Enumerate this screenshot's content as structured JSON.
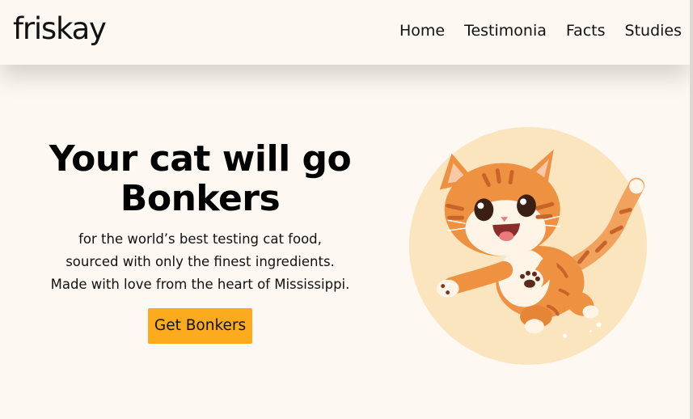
{
  "brand": {
    "logo_text": "friskay"
  },
  "nav": {
    "items": [
      {
        "label": "Home"
      },
      {
        "label": "Testimonia"
      },
      {
        "label": "Facts"
      },
      {
        "label": "Studies"
      }
    ]
  },
  "hero": {
    "headline_line1": "Your cat will go",
    "headline_line2": "Bonkers",
    "sub_line1": "for the world’s best testing cat food,",
    "sub_line2": "sourced with only the finest ingredients.",
    "sub_line3": "Made with love from the heart of Mississippi.",
    "cta_label": "Get Bonkers",
    "image_subject": "happy-orange-kitten-illustration"
  },
  "colors": {
    "page_background": "#fdf8f1",
    "accent_button": "#fcab1f",
    "image_circle": "#fbe5bf",
    "kitten_orange": "#ee9140"
  }
}
